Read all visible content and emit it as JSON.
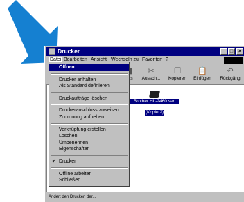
{
  "window": {
    "title": "Drucker"
  },
  "menubar": [
    "Datei",
    "Bearbeiten",
    "Ansicht",
    "Wechseln zu",
    "Favoriten",
    "?"
  ],
  "toolbar": [
    {
      "label": "rts",
      "icon": "printer-icon"
    },
    {
      "label": "Aussch...",
      "icon": "cut-icon"
    },
    {
      "label": "Kopieren",
      "icon": "copy-icon"
    },
    {
      "label": "Einfügen",
      "icon": "paste-icon"
    },
    {
      "label": "Rückgäng",
      "icon": "undo-icon"
    }
  ],
  "printer": {
    "line1": "Brother HL-2460 sen",
    "line2": "(Kopie 2)"
  },
  "file_menu": {
    "open": "Öffnen",
    "pause": "Drucker anhalten",
    "set_default": "Als Standard definieren",
    "purge": "Druckaufträge löschen",
    "capture": "Druckeranschluss zuweisen...",
    "release": "Zuordnung aufheben...",
    "shortcut": "Verknüpfung erstellen",
    "delete": "Löschen",
    "rename": "Umbenennen",
    "properties": "Eigenschaften",
    "printer": "Drucker",
    "offline": "Offline arbeiten",
    "close": "Schließen"
  },
  "statusbar": {
    "text": "Ändert den Drucker, der..."
  },
  "colors": {
    "arrow": "#1580d1",
    "selection": "#000080",
    "window_face": "#c0c0c0"
  }
}
